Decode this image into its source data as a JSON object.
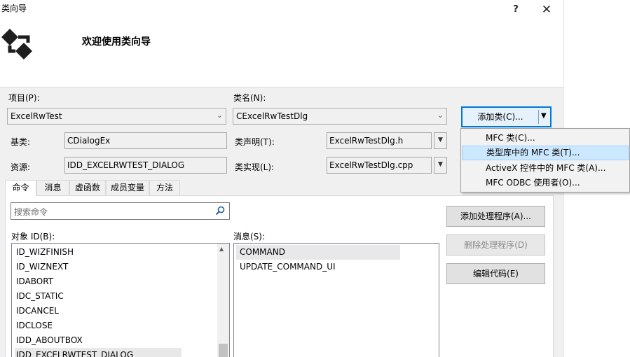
{
  "window": {
    "title": "类向导",
    "help_button": "?",
    "close_button": "✕",
    "welcome": "欢迎使用类向导"
  },
  "fields": {
    "project_label": "项目(P):",
    "project_value": "ExcelRwTest",
    "classname_label": "类名(N):",
    "classname_value": "CExcelRwTestDlg",
    "base_label": "基类:",
    "base_value": "CDialogEx",
    "resource_label": "资源:",
    "resource_value": "IDD_EXCELRWTEST_DIALOG",
    "declaration_label": "类声明(T):",
    "declaration_value": "ExcelRwTestDlg.h",
    "implementation_label": "类实现(L):",
    "implementation_value": "ExcelRwTestDlg.cpp"
  },
  "add_class_button": {
    "label": "添加类(C)...",
    "arrow": "▼"
  },
  "add_class_menu": {
    "items": [
      "MFC 类(C)...",
      "类型库中的 MFC 类(T)...",
      "ActiveX 控件中的 MFC 类(A)...",
      "MFC ODBC 使用者(O)..."
    ],
    "highlighted_index": 1
  },
  "tabs": [
    "命令",
    "消息",
    "虚函数",
    "成员变量",
    "方法"
  ],
  "active_tab": 0,
  "search": {
    "placeholder": "搜索命令",
    "icon": "search-icon"
  },
  "object_ids": {
    "label": "对象 ID(B):",
    "items": [
      "ID_WIZFINISH",
      "ID_WIZNEXT",
      "IDABORT",
      "IDC_STATIC",
      "IDCANCEL",
      "IDCLOSE",
      "IDD_ABOUTBOX",
      "IDD_EXCELRWTEST_DIALOG"
    ]
  },
  "messages": {
    "label": "消息(S):",
    "items": [
      "COMMAND",
      "UPDATE_COMMAND_UI"
    ],
    "selected_index": 0
  },
  "handler_buttons": {
    "add": "添加处理程序(A)...",
    "delete": "删除处理程序(D)",
    "edit": "编辑代码(E)"
  },
  "colors": {
    "accent": "#0078d7",
    "menu_highlight": "#cce8ff",
    "dialog_bg": "#f0f0f0"
  }
}
